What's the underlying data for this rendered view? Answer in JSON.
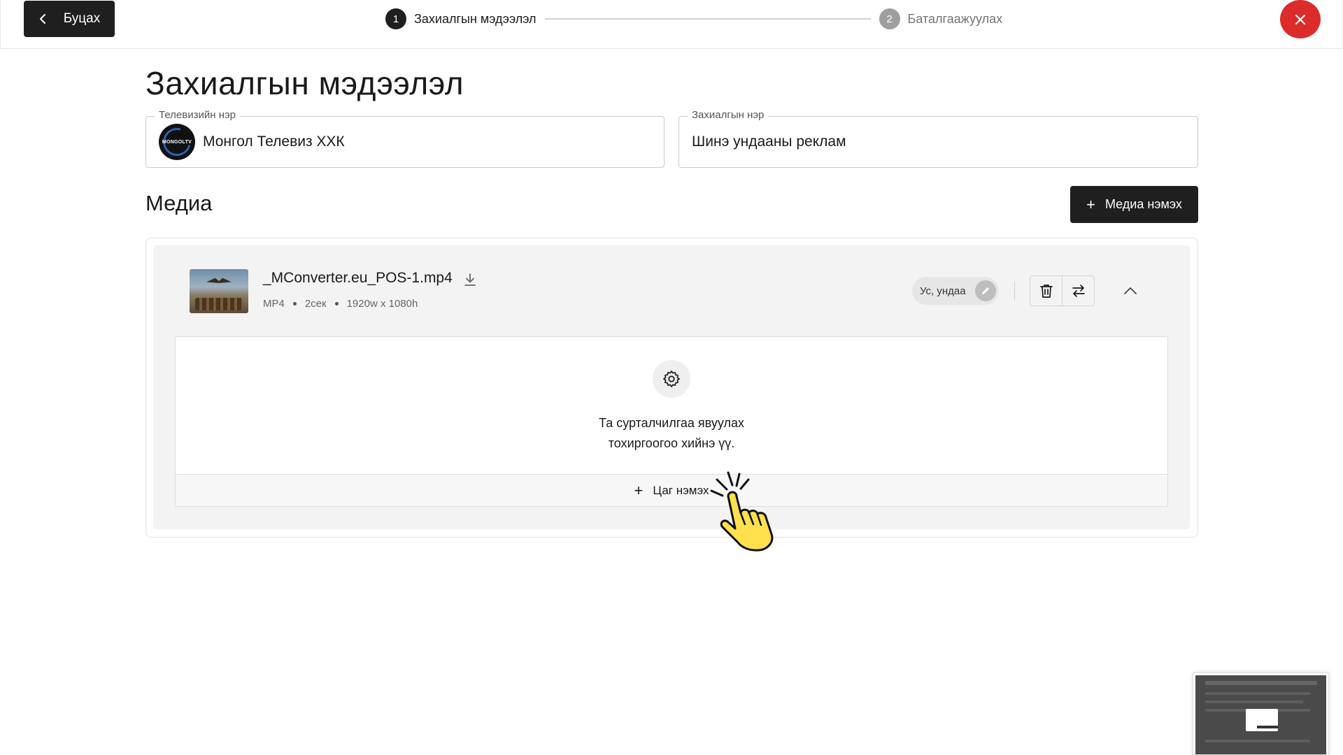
{
  "header": {
    "back_label": "Буцах",
    "steps": [
      {
        "num": "1",
        "label": "Захиалгын мэдээлэл",
        "state": "active"
      },
      {
        "num": "2",
        "label": "Баталгаажуулах",
        "state": "inactive"
      }
    ]
  },
  "page": {
    "title": "Захиалгын мэдээлэл",
    "tv_field": {
      "legend": "Телевизийн нэр",
      "value": "Монгол Телевиз ХХК",
      "logo_text": "MONGOLTV"
    },
    "order_field": {
      "legend": "Захиалгын нэр",
      "value": "Шинэ ундааны реклам"
    }
  },
  "media": {
    "section_title": "Медиа",
    "add_button": "Медиа нэмэх",
    "item": {
      "file_name": "_MConverter.eu_POS-1.mp4",
      "format": "MP4",
      "duration": "2сек",
      "resolution": "1920w x 1080h",
      "status_chip": "Ус, ундаа"
    },
    "empty_state": {
      "line1": "Та сурталчилгаа явуулах",
      "line2": "тохиргоогоо хийнэ үү."
    },
    "add_time_label": "Цаг нэмэх"
  },
  "colors": {
    "primary_dark": "#1f1f1f",
    "close_red": "#dc2b2b",
    "inactive_step": "#9e9e9e",
    "card_bg": "#f3f3f3",
    "cursor_yellow": "#ffe14d"
  },
  "icons": {
    "back": "chevron-left-icon",
    "close": "close-icon",
    "plus": "plus-icon",
    "download": "download-icon",
    "edit": "pencil-icon",
    "delete": "trash-icon",
    "replace": "swap-icon",
    "collapse": "chevron-up-icon",
    "settings": "gear-icon",
    "cursor": "hand-pointer-icon"
  }
}
